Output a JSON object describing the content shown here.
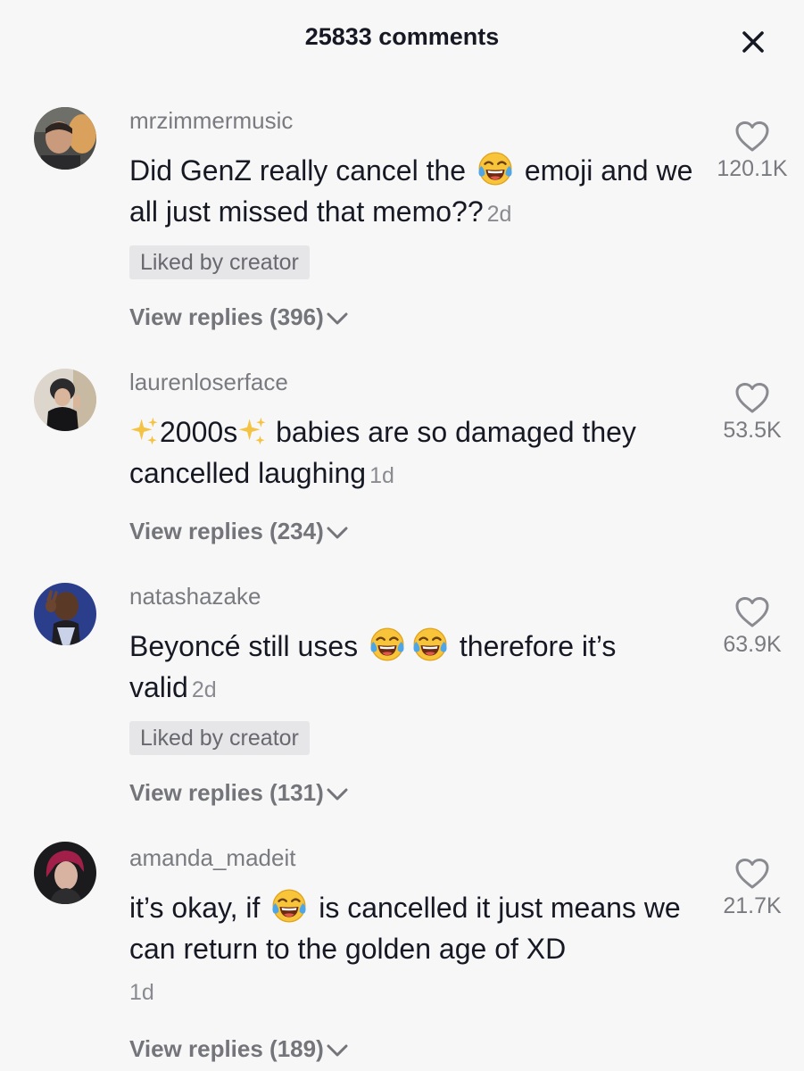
{
  "header": {
    "title": "25833 comments",
    "close_icon": "close-icon"
  },
  "comments": [
    {
      "username": "mrzimmermusic",
      "text_parts": [
        "Did GenZ really cancel the ",
        " emoji and we all just missed that memo??"
      ],
      "emoji": "face-with-tears-of-joy",
      "time": "2d",
      "liked_by_creator": "Liked by creator",
      "view_replies": "View replies (396)",
      "likes": "120.1K"
    },
    {
      "username": "laurenloserface",
      "text_parts": [
        "2000s",
        " babies are so damaged they cancelled laughing"
      ],
      "emoji": "sparkles",
      "time": "1d",
      "view_replies": "View replies (234)",
      "likes": "53.5K"
    },
    {
      "username": "natashazake",
      "text_parts": [
        "Beyoncé still uses ",
        " therefore it’s valid"
      ],
      "emoji": "face-with-tears-of-joy",
      "time": "2d",
      "liked_by_creator": "Liked by creator",
      "view_replies": "View replies (131)",
      "likes": "63.9K"
    },
    {
      "username": "amanda_madeit",
      "text_parts": [
        "it’s okay, if ",
        " is cancelled it just means we can return to the golden age of XD"
      ],
      "emoji": "face-with-tears-of-joy",
      "time": "1d",
      "view_replies": "View replies (189)",
      "likes": "21.7K"
    }
  ],
  "colors": {
    "background": "#f7f7f7",
    "text_primary": "#161823",
    "text_secondary": "#7a7b80",
    "badge_bg": "#e6e6e8"
  }
}
